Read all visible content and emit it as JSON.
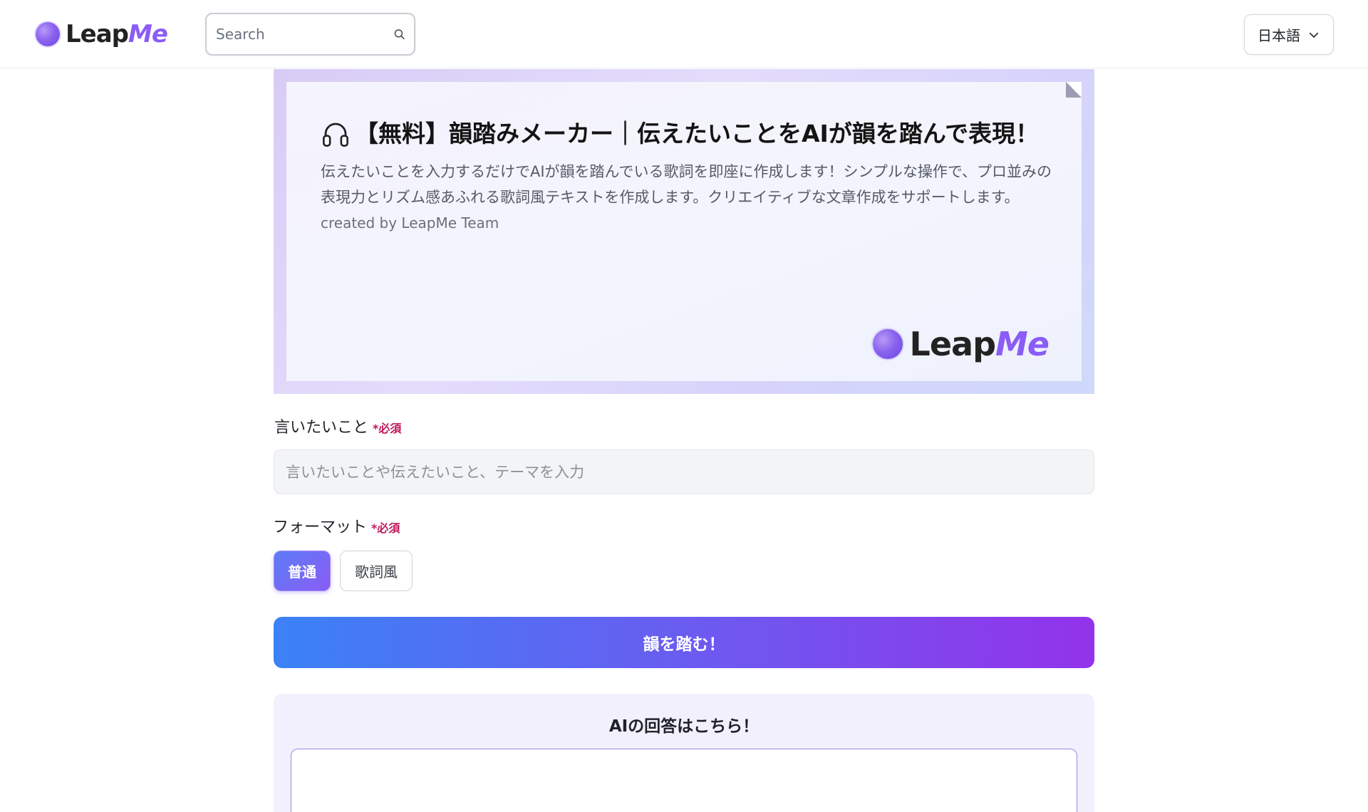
{
  "header": {
    "logo_lead": "Leap",
    "logo_accent": "Me",
    "search_placeholder": "Search",
    "language": "日本語"
  },
  "hero": {
    "title": "【無料】韻踏みメーカー｜伝えたいことをAIが韻を踏んで表現！",
    "description": "伝えたいことを入力するだけでAIが韻を踏んでいる歌詞を即座に作成します！シンプルな操作で、プロ並みの表現力とリズム感あふれる歌詞風テキストを作成します。クリエイティブな文章作成をサポートします。",
    "credit": "created by LeapMe Team",
    "logo_lead": "Leap",
    "logo_accent": "Me"
  },
  "form": {
    "say_label": "言いたいこと",
    "say_required": "*必須",
    "say_placeholder": "言いたいことや伝えたいこと、テーマを入力",
    "say_value": "",
    "format_label": "フォーマット",
    "format_required": "*必須",
    "format_options": [
      {
        "label": "普通",
        "selected": true
      },
      {
        "label": "歌詞風",
        "selected": false
      }
    ],
    "submit_label": "韻を踏む！"
  },
  "answer": {
    "title": "AIの回答はこちら！"
  },
  "colors": {
    "accent_purple": "#8b5cf6",
    "gradient_start": "#3b82f6",
    "gradient_end": "#9333ea",
    "required_red": "#c2185b"
  },
  "icons": {
    "search": "search-icon",
    "chevron": "chevron-down-icon",
    "headphone": "headphone-icon"
  }
}
